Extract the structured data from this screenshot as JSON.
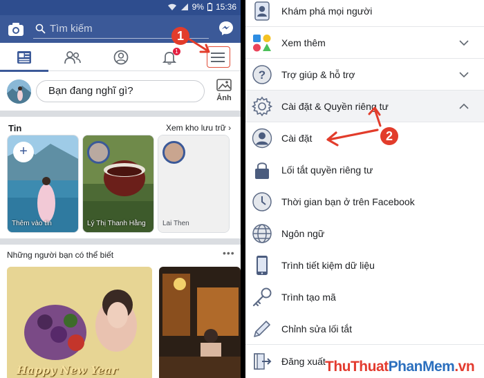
{
  "status_bar": {
    "battery": "9%",
    "time": "15:36"
  },
  "topbar": {
    "search_placeholder": "Tìm kiếm"
  },
  "tabs": {
    "notification_count": "1"
  },
  "composer": {
    "placeholder": "Bạn đang nghĩ gì?",
    "photo_label": "Ảnh"
  },
  "stories": {
    "title": "Tin",
    "archive_link": "Xem kho lưu trữ",
    "items": [
      {
        "label": "Thêm vào tin"
      },
      {
        "label": "Lý Thị Thanh Hằng"
      },
      {
        "label": "Lai Then"
      }
    ]
  },
  "suggestions": {
    "title": "Những người bạn có thể biết",
    "card_text": "Happy New Year"
  },
  "menu": {
    "items": [
      {
        "label": "Khám phá mọi người",
        "icon": "people-icon"
      },
      {
        "label": "Xem thêm",
        "icon": "shapes-icon"
      },
      {
        "label": "Trợ giúp & hỗ trợ",
        "icon": "help-icon"
      },
      {
        "label": "Cài đặt & Quyền riêng tư",
        "icon": "gear-icon"
      },
      {
        "label": "Cài đặt",
        "icon": "user-icon"
      },
      {
        "label": "Lối tắt quyền riêng tư",
        "icon": "lock-icon"
      },
      {
        "label": "Thời gian bạn ở trên Facebook",
        "icon": "clock-icon"
      },
      {
        "label": "Ngôn ngữ",
        "icon": "globe-icon"
      },
      {
        "label": "Trình tiết kiệm dữ liệu",
        "icon": "phone-icon"
      },
      {
        "label": "Trình tạo mã",
        "icon": "key-icon"
      },
      {
        "label": "Chỉnh sửa lối tắt",
        "icon": "pencil-icon"
      },
      {
        "label": "Đăng xuất",
        "icon": "logout-icon"
      }
    ]
  },
  "annotations": {
    "step1": "1",
    "step2": "2"
  },
  "watermark": {
    "part1": "ThuThuat",
    "part2": "PhanMem",
    "part3": ".vn"
  },
  "colors": {
    "facebook_blue": "#3b5998",
    "annotation_red": "#e23c2b"
  }
}
